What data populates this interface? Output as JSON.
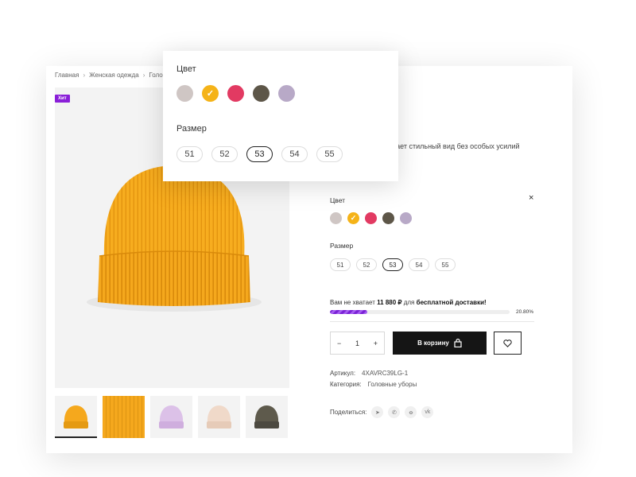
{
  "breadcrumb": {
    "home": "Главная",
    "women": "Женская одежда",
    "hats": "Головные"
  },
  "badge": {
    "label": "Хит"
  },
  "description_fragment": "придает стильный вид без особых усилий",
  "close_glyph": "×",
  "color": {
    "label": "Цвет",
    "swatches": [
      {
        "name": "beige-grey",
        "color": "#cfc6c4"
      },
      {
        "name": "yellow",
        "color": "#f5b318",
        "selected": true
      },
      {
        "name": "pink",
        "color": "#e23a62"
      },
      {
        "name": "olive",
        "color": "#5d5648"
      },
      {
        "name": "lavender",
        "color": "#b8a9c7"
      }
    ]
  },
  "size": {
    "label": "Размер",
    "options": [
      "51",
      "52",
      "53",
      "54",
      "55"
    ],
    "selected": "53"
  },
  "shipping": {
    "prefix": "Вам не хватает",
    "amount": "11 880 ₽",
    "mid": "для",
    "target": "бесплатной доставки!",
    "progress_percent": 20.8,
    "progress_label": "20.80%"
  },
  "quantity": {
    "minus": "−",
    "value": "1",
    "plus": "+"
  },
  "cart_button": {
    "label": "В корзину"
  },
  "meta": {
    "sku_label": "Артикул:",
    "sku_value": "4XAVRC39LG-1",
    "category_label": "Категория:",
    "category_value": "Головные уборы"
  },
  "share": {
    "label": "Поделиться:",
    "icons": [
      "telegram-icon",
      "whatsapp-icon",
      "odnoklassniki-icon",
      "vk-icon"
    ],
    "glyphs": [
      "➤",
      "✆",
      "ꝋ",
      "vk"
    ]
  },
  "colors": {
    "accent": "#8a1fd8",
    "button": "#151515",
    "hat": "#f5a81d"
  }
}
